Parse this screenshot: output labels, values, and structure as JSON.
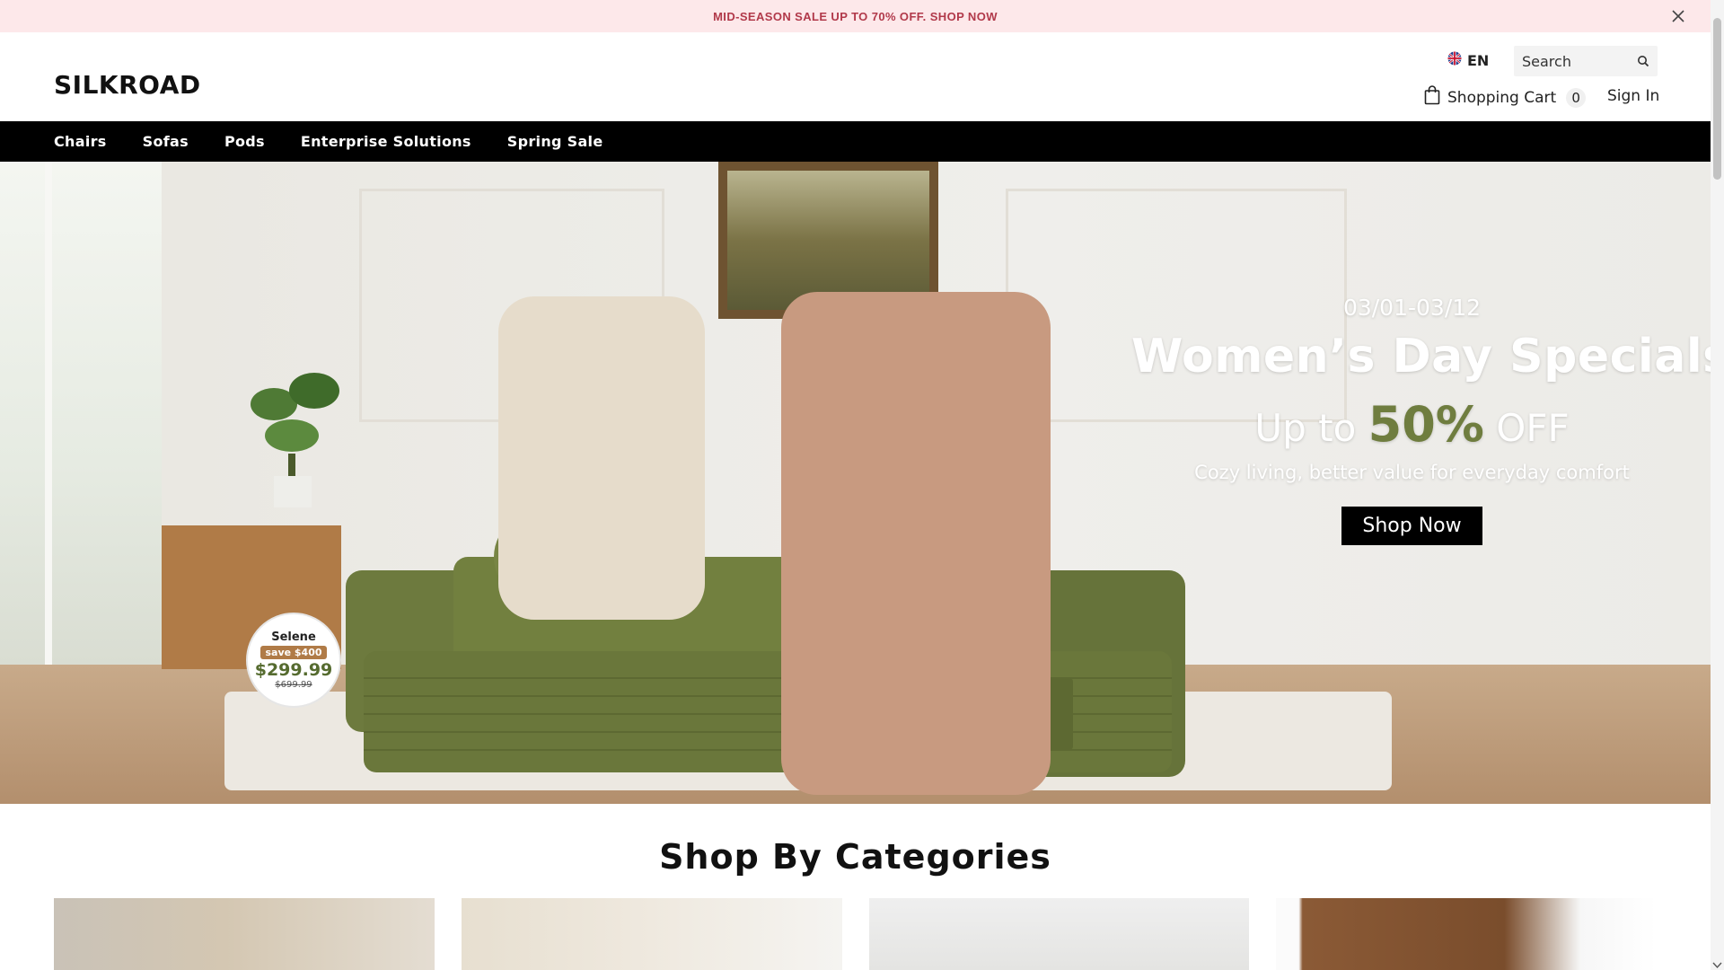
{
  "announcement": {
    "text": "MID-SEASON SALE UP TO 70% OFF. SHOP NOW",
    "close_icon": "close-icon"
  },
  "header": {
    "logo": "SILKROAD",
    "language": {
      "flag_icon": "uk-flag-icon",
      "label": "EN"
    },
    "search": {
      "placeholder": "Search",
      "icon": "search-icon"
    },
    "cart": {
      "icon": "shopping-bag-icon",
      "label": "Shopping Cart",
      "count": "0"
    },
    "signin_label": "Sign In"
  },
  "nav": {
    "items": [
      "Chairs",
      "Sofas",
      "Pods",
      "Enterprise Solutions",
      "Spring Sale"
    ]
  },
  "hero": {
    "date": "03/01-03/12",
    "title": "Women’s Day Specials",
    "offer_prefix": "Up to",
    "offer_percent": "50%",
    "offer_suffix": "OFF",
    "subtitle": "Cozy living, better value for everyday comfort",
    "cta_label": "Shop Now",
    "badge": {
      "name": "Selene",
      "save": "save $400",
      "price": "$299.99",
      "old_price": "$699.99"
    }
  },
  "categories": {
    "title": "Shop By Categories"
  },
  "colors": {
    "announce_bg": "#fde8ea",
    "announce_text": "#b1394a",
    "nav_bg": "#000000",
    "accent_green": "#6f7d3f"
  }
}
